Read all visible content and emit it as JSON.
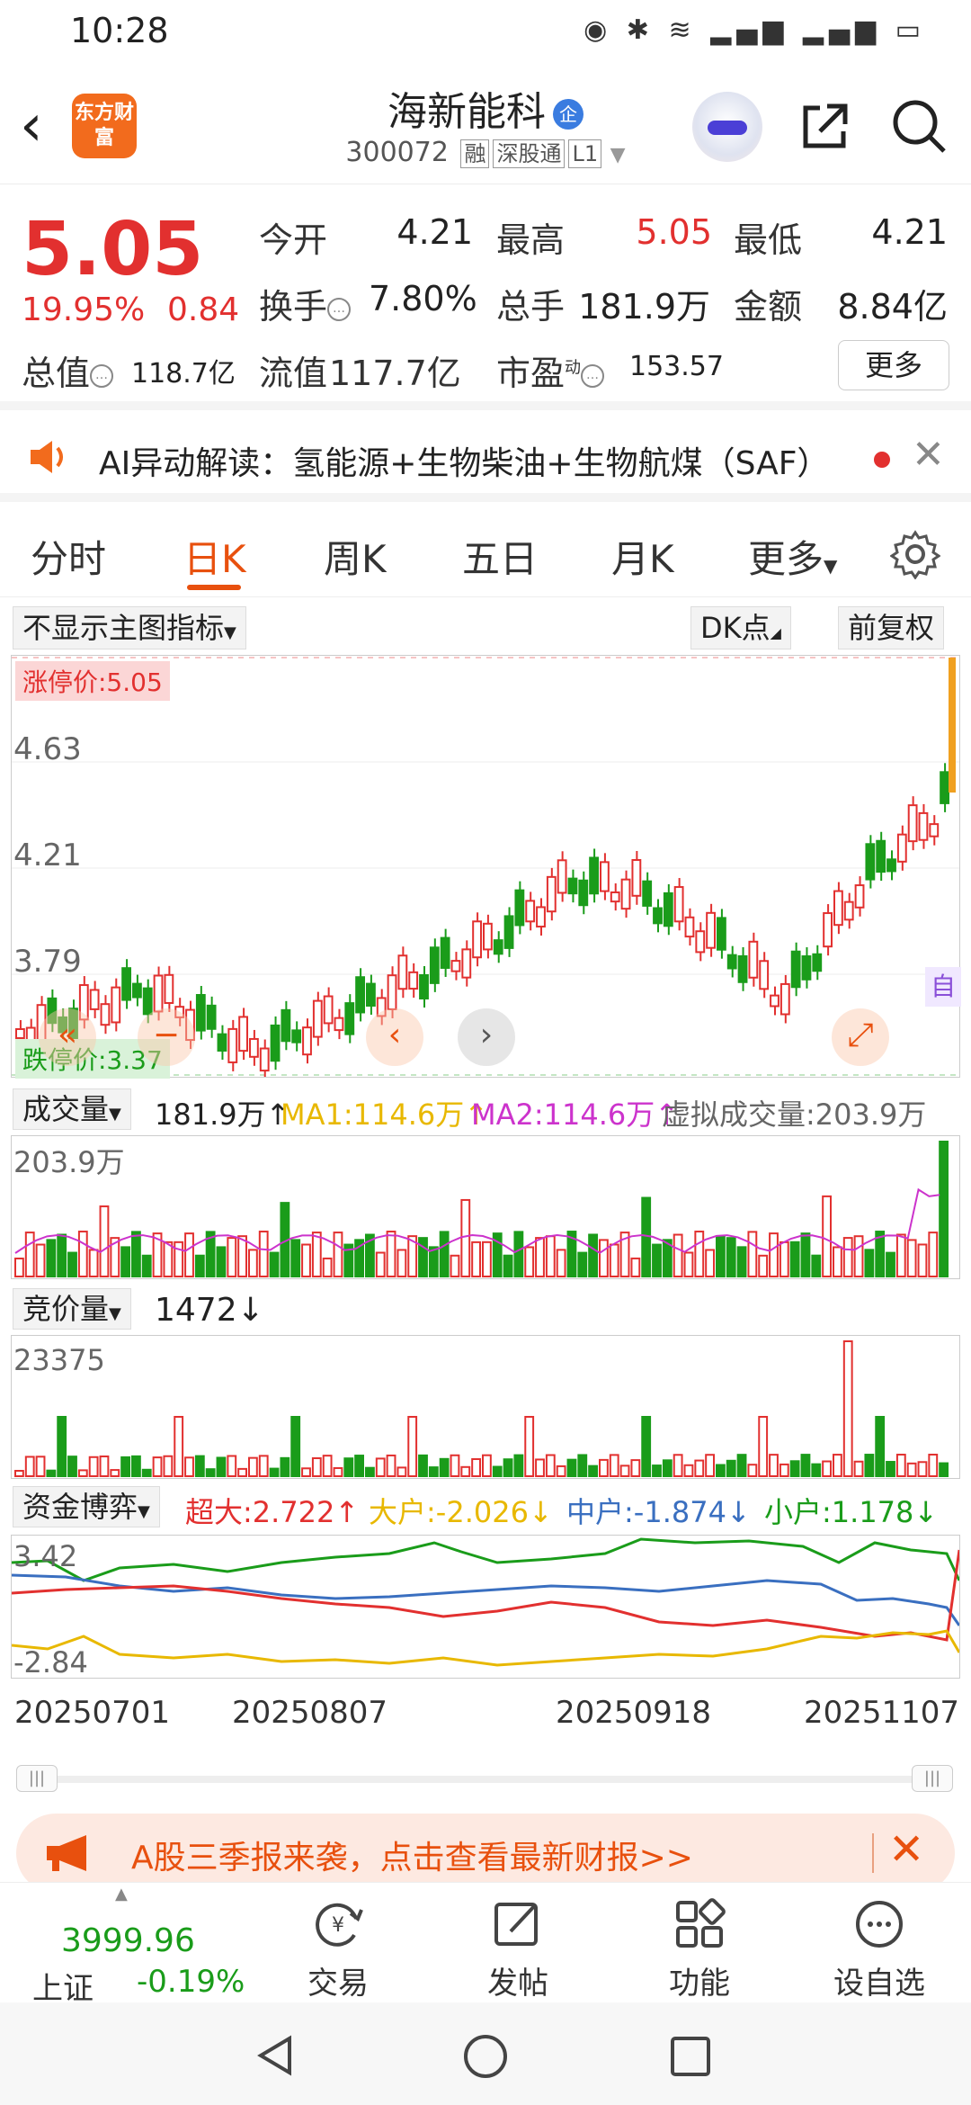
{
  "status_bar": {
    "time": "10:28"
  },
  "header": {
    "logo_text": "东方财富",
    "stock_name": "海新能科",
    "stock_badge": "企",
    "stock_code": "300072",
    "tags": [
      "融",
      "深股通",
      "L1"
    ]
  },
  "quote": {
    "price": "5.05",
    "change_pct": "19.95%",
    "change_amt": "0.84",
    "open_label": "今开",
    "open": "4.21",
    "high_label": "最高",
    "high": "5.05",
    "low_label": "最低",
    "low": "4.21",
    "turnover_label": "换手",
    "turnover": "7.80%",
    "volume_label": "总手",
    "volume": "181.9万",
    "amount_label": "金额",
    "amount": "8.84亿",
    "mktcap_label": "总值",
    "mktcap": "118.7亿",
    "float_label": "流值",
    "float": "117.7亿",
    "pe_label": "市盈",
    "pe_sup": "动",
    "pe": "153.57",
    "more_label": "更多"
  },
  "ai_bar": {
    "text": "AI异动解读：氢能源+生物柴油+生物航煤（SAF）"
  },
  "tabs": {
    "items": [
      "分时",
      "日K",
      "周K",
      "五日",
      "月K",
      "更多"
    ],
    "active": "日K"
  },
  "chart_tools": {
    "indicator": "不显示主图指标",
    "dk": "DK点",
    "adjust": "前复权"
  },
  "kline": {
    "y_labels": [
      "4.63",
      "4.21",
      "3.79"
    ],
    "limit_up": "涨停价:5.05",
    "limit_down": "跌停价:3.37",
    "marker_label": "自"
  },
  "volume": {
    "selector": "成交量",
    "value": "181.9万↑",
    "ma1": "MA1:114.6万↑",
    "ma2": "MA2:114.6万↑",
    "virtual": "虚拟成交量:203.9万",
    "max_label": "203.9万"
  },
  "bid_volume": {
    "selector": "竞价量",
    "value": "1472↓",
    "max_label": "23375"
  },
  "fund_flow": {
    "selector": "资金博弈",
    "super": "超大:2.722↑",
    "large": "大户:-2.026↓",
    "medium": "中户:-1.874↓",
    "small": "小户:1.178↓",
    "top_label": "3.42",
    "bottom_label": "-2.84"
  },
  "dates": [
    "20250701",
    "20250807",
    "20250918",
    "20251107"
  ],
  "banner": {
    "text": "A股三季报来袭，点击查看最新财报>>"
  },
  "bottom_nav": {
    "index_value": "3999.96",
    "index_name": "上证",
    "index_change": "-0.19%",
    "items": [
      "交易",
      "发帖",
      "功能",
      "设自选"
    ]
  },
  "colors": {
    "up": "#e2302f",
    "down": "#1a9c1a",
    "accent": "#e8500e",
    "ma1": "#e8b800",
    "ma2": "#cc33cc",
    "medium": "#3a6fc0"
  }
}
